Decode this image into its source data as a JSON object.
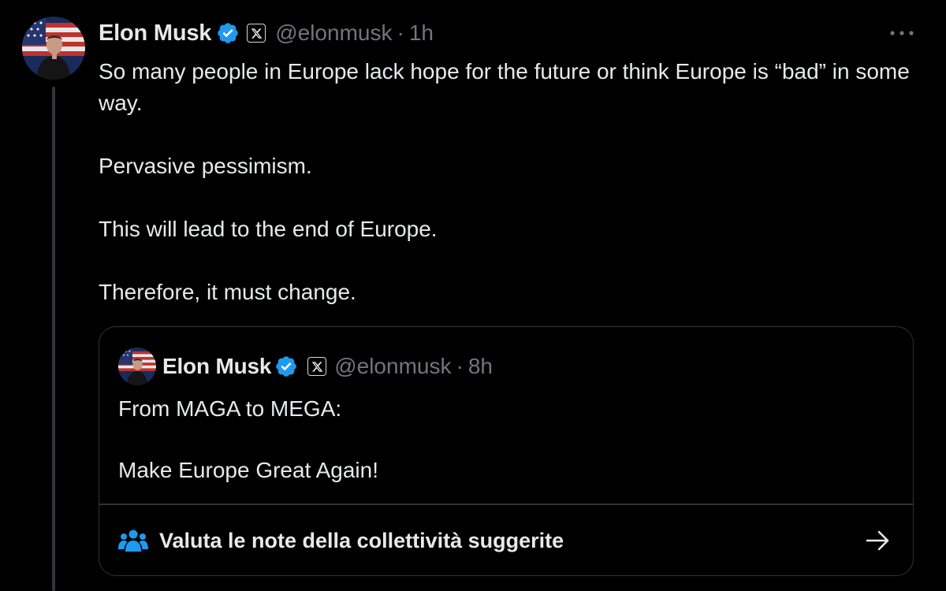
{
  "tweet": {
    "author_name": "Elon Musk",
    "handle": "@elonmusk",
    "separator": "·",
    "time": "1h",
    "paragraphs": [
      "So many people in Europe lack hope for the future or think Europe is “bad” in some way.",
      "Pervasive pessimism.",
      "This will lead to the end of Europe.",
      "Therefore, it must change."
    ],
    "more_icon": "more-horizontal-icon"
  },
  "quoted_tweet": {
    "author_name": "Elon Musk",
    "handle": "@elonmusk",
    "separator": "·",
    "time": "8h",
    "paragraphs": [
      "From MAGA to MEGA:",
      "Make Europe Great Again!"
    ]
  },
  "community_notes": {
    "label": "Valuta le note della collettività suggerite",
    "icon": "people-icon",
    "action_icon": "arrow-right-icon"
  },
  "colors": {
    "background": "#000000",
    "text_primary": "#e7e9ea",
    "text_secondary": "#71767b",
    "verified_blue": "#1d9bf0",
    "border": "#2f3336"
  }
}
